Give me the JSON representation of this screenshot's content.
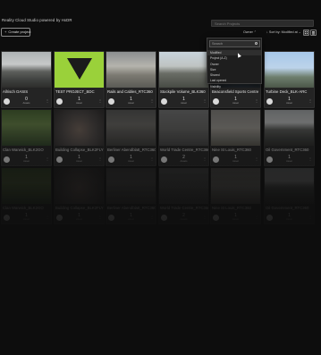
{
  "app": {
    "title": "Reality Cloud Studio powered by HxDR"
  },
  "header": {
    "search_placeholder": "Search Projects",
    "create_label": "Create project",
    "owner_filter": "Owner",
    "sort_label": "Sort by: Modified at"
  },
  "dropdown": {
    "search_placeholder": "Search",
    "options": [
      "Modified",
      "Project (A-Z)",
      "Owner",
      "Size",
      "Shared",
      "Last opened",
      "Visibility"
    ]
  },
  "projects": [
    {
      "name": "Allrisch OASIS",
      "count": "0",
      "count_label": "Assets",
      "thumb": "t-bldg"
    },
    {
      "name": "TEST PROJECT_BDC",
      "count": "1",
      "count_label": "Asset",
      "thumb": "t-green"
    },
    {
      "name": "Rails and Cables_RTC360",
      "count": "1",
      "count_label": "Asset",
      "thumb": "t-hall"
    },
    {
      "name": "Stockpile Volume_BLK360",
      "count": "1",
      "count_label": "Asset",
      "thumb": "t-pile"
    },
    {
      "name": "Beaconsfield Sports Centre",
      "count": "1",
      "count_label": "Asset",
      "thumb": "t-dark"
    },
    {
      "name": "Turbine Deck_BLK-ARC",
      "count": "1",
      "count_label": "Asset",
      "thumb": "t-wind"
    },
    {
      "name": "Clan Warwick_BLK2GO",
      "count": "1",
      "count_label": "Asset",
      "thumb": "t-forest"
    },
    {
      "name": "Building Collapse_BLK2FLY",
      "count": "1",
      "count_label": "Asset",
      "thumb": "t-rubble"
    },
    {
      "name": "Berliner Abendblatt_RTC360",
      "count": "1",
      "count_label": "Asset",
      "thumb": "t-stone"
    },
    {
      "name": "World Trade Centre_RTC360",
      "count": "2",
      "count_label": "Assets",
      "thumb": "t-gray"
    },
    {
      "name": "Nine St Louis_RTC360",
      "count": "1",
      "count_label": "Asset",
      "thumb": "t-church"
    },
    {
      "name": "Oil Government_RTC360",
      "count": "1",
      "count_label": "Asset",
      "thumb": "t-bldg"
    },
    {
      "name": "Clan Warwick_BLK2GO",
      "count": "1",
      "count_label": "Asset",
      "thumb": "t-forest"
    },
    {
      "name": "Building Collapse_BLK2FLY",
      "count": "1",
      "count_label": "Asset",
      "thumb": "t-rubble"
    },
    {
      "name": "Berliner Abendblatt_RTC360",
      "count": "1",
      "count_label": "Asset",
      "thumb": "t-stone"
    },
    {
      "name": "World Trade Centre_RTC360",
      "count": "2",
      "count_label": "Assets",
      "thumb": "t-gray"
    },
    {
      "name": "Nine St Louis_RTC360",
      "count": "1",
      "count_label": "Asset",
      "thumb": "t-church"
    },
    {
      "name": "Oil Government_RTC360",
      "count": "1",
      "count_label": "Asset",
      "thumb": "t-bldg"
    }
  ]
}
